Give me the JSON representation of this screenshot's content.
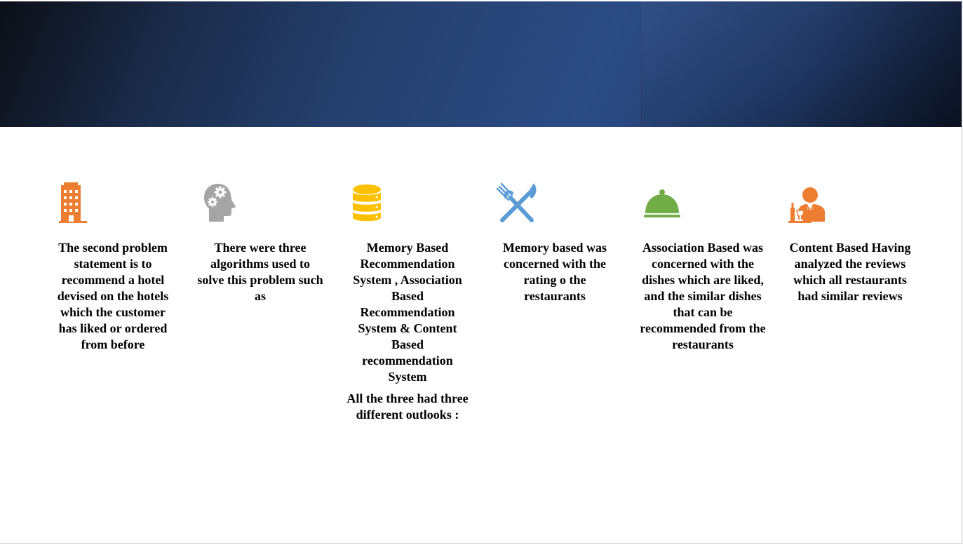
{
  "columns": [
    {
      "icon": "building-icon",
      "color": "#ED7D31",
      "paragraphs": [
        "The second problem statement is to recommend a hotel devised on the hotels which the customer has liked or ordered from before"
      ]
    },
    {
      "icon": "head-gears-icon",
      "color": "#A5A5A5",
      "paragraphs": [
        "There were three algorithms used to solve this problem such as"
      ]
    },
    {
      "icon": "database-icon",
      "color": "#FFC000",
      "paragraphs": [
        "Memory Based Recommendation System , Association Based Recommendation System & Content Based recommendation System",
        "All the three had three different outlooks :"
      ]
    },
    {
      "icon": "fork-knife-icon",
      "color": "#5B9BD5",
      "paragraphs": [
        "Memory based was concerned with the rating o the restaurants"
      ]
    },
    {
      "icon": "cloche-icon",
      "color": "#70AD47",
      "paragraphs": [
        "Association Based was concerned with the dishes which are liked, and the similar dishes that can be recommended from the restaurants"
      ]
    },
    {
      "icon": "waiter-icon",
      "color": "#ED7D31",
      "paragraphs": [
        "Content Based Having analyzed the reviews which all restaurants had similar reviews"
      ]
    }
  ]
}
